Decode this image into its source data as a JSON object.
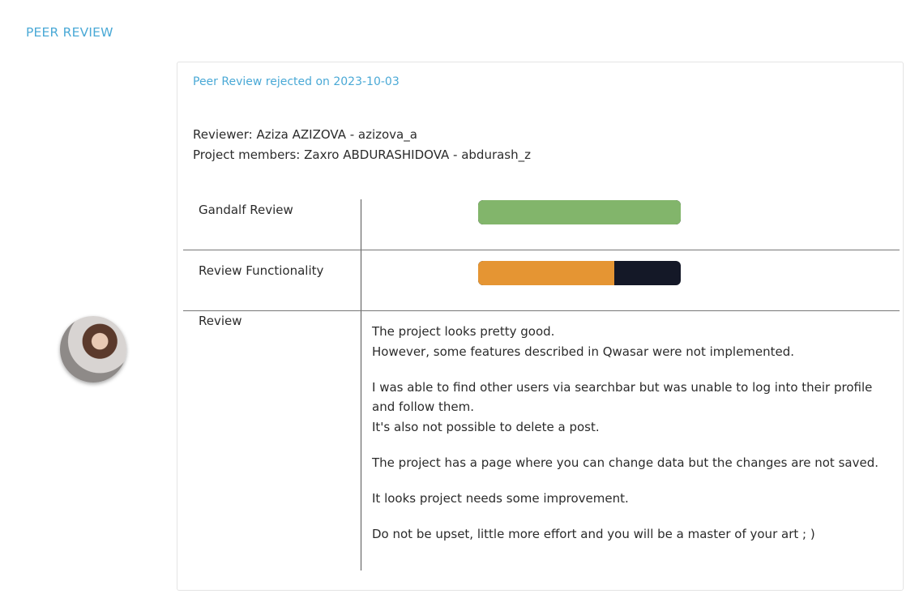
{
  "section": {
    "title": "PEER REVIEW"
  },
  "review": {
    "status": "Peer Review rejected on 2023-10-03",
    "reviewer": "Reviewer: Aziza AZIZOVA - azizova_a",
    "members": "Project members: Zaxro ABDURASHIDOVA - abdurash_z"
  },
  "metrics": [
    {
      "label": "Gandalf Review",
      "progress": 1.0,
      "color": "#82b56b"
    },
    {
      "label": "Review Functionality",
      "progress": 0.67,
      "color": "#e59533"
    }
  ],
  "review_label": "Review",
  "review_paragraphs": [
    [
      "The project looks pretty good.",
      "However, some features described in Qwasar were not implemented."
    ],
    [
      "I was able to find other users via searchbar but was unable to log into their profile and follow them.",
      "It's also not possible to delete a post."
    ],
    [
      "The project has a page where you can change data but the changes are not saved."
    ],
    [
      "It looks project needs some improvement."
    ],
    [
      "Do not be upset, little more effort and you will be a master of your art ; )"
    ]
  ],
  "colors": {
    "accent": "#4aa9d6",
    "bar_track": "#141827"
  }
}
